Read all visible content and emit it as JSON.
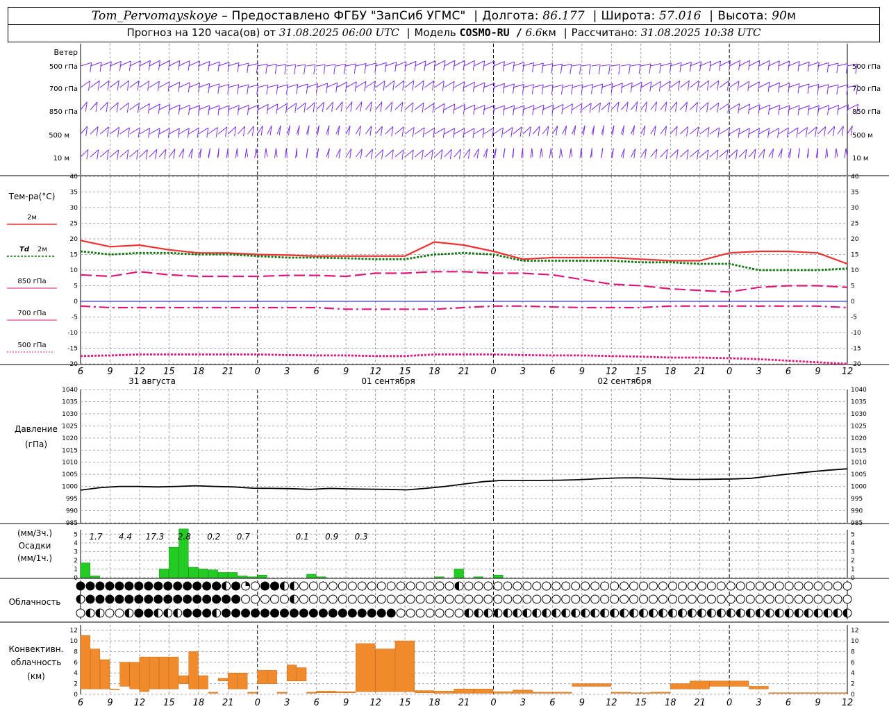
{
  "header": {
    "station": "Tom_Pervomayskoye",
    "provided": "– Предоставлено ФГБУ \"ЗапСиб УГМС\"",
    "lon_label": "Долгота:",
    "lon": "86.177",
    "lat_label": "Широта:",
    "lat": "57.016",
    "alt_label": "Высота:",
    "alt": "90",
    "alt_unit": "м",
    "forecast_label": "Прогноз на 120 часа(ов) от",
    "forecast_time": "31.08.2025 06:00 UTC",
    "model_label": "Модель",
    "model": "COSMO-RU /",
    "resolution": "6.6",
    "res_unit": "км",
    "calc_label": "Рассчитано:",
    "calc_time": "31.08.2025 10:38 UTC"
  },
  "labels": {
    "wind_title": "Ветер",
    "wind_levels": [
      "500 гПа",
      "700 гПа",
      "850 гПа",
      "500 м",
      "10 м"
    ],
    "temp_title": "Тем-ра(°С)",
    "temp_legend": [
      {
        "key": "2м",
        "prefix": "",
        "color": "#ee3030"
      },
      {
        "key": "2м",
        "prefix": "Td",
        "color": "#117711"
      },
      {
        "key": "850 гПа",
        "prefix": "",
        "color": "#e0157a"
      },
      {
        "key": "700 гПа",
        "prefix": "",
        "color": "#e0157a"
      },
      {
        "key": "500 гПа",
        "prefix": "",
        "color": "#e0157a"
      }
    ],
    "pressure_title": "Давление",
    "pressure_unit": "(гПа)",
    "precip_unit3": "(мм/3ч.)",
    "precip_title": "Осадки",
    "precip_unit1": "(мм/1ч.)",
    "cloud_title": "Облачность",
    "conv_title1": "Конвективн.",
    "conv_title2": "облачность",
    "conv_unit": "(км)",
    "days": [
      "31 августа",
      "01 сентября",
      "02 сентября"
    ],
    "hour_ticks": [
      "6",
      "9",
      "12",
      "15",
      "18",
      "21",
      "0",
      "3",
      "6",
      "9",
      "12",
      "15",
      "18",
      "21",
      "0",
      "3",
      "6",
      "9",
      "12",
      "15",
      "18",
      "21",
      "0",
      "3",
      "6",
      "9",
      "12"
    ]
  },
  "chart_data": [
    {
      "type": "line",
      "title": "Тем-ра(°С)",
      "x_hours": [
        0,
        3,
        6,
        9,
        12,
        15,
        18,
        21,
        24,
        27,
        30,
        33,
        36,
        39,
        42,
        45,
        48,
        51,
        54,
        57,
        60,
        63,
        66,
        69,
        72,
        75,
        78
      ],
      "ylim": [
        -20,
        40
      ],
      "series": [
        {
          "name": "2м",
          "color": "#ee3030",
          "style": "solid",
          "values": [
            19.5,
            17.5,
            18,
            16.5,
            15.5,
            15.5,
            15,
            14.8,
            14.5,
            14.5,
            14.5,
            14.5,
            19,
            18,
            16,
            13.5,
            14,
            14,
            14,
            13.5,
            13,
            13,
            15.5,
            16,
            16,
            15.5,
            12
          ]
        },
        {
          "name": "Td 2м",
          "color": "#117711",
          "style": "dotted",
          "values": [
            16,
            15,
            15.5,
            15.5,
            15,
            15,
            14.5,
            14,
            14,
            13.8,
            13.5,
            13.5,
            15,
            15.5,
            15,
            13,
            13,
            13,
            13,
            12.5,
            12.5,
            12,
            12,
            10,
            10,
            10,
            10.5
          ]
        },
        {
          "name": "850 гПа",
          "color": "#e0157a",
          "style": "dashed",
          "values": [
            8.5,
            8,
            9.5,
            8.5,
            8,
            8,
            8,
            8.3,
            8.3,
            8,
            9,
            9,
            9.5,
            9.5,
            9,
            9,
            8.5,
            7,
            5.5,
            5,
            4,
            3.5,
            3,
            4.5,
            5,
            5,
            4.5
          ]
        },
        {
          "name": "700 гПа",
          "color": "#e0157a",
          "style": "dashdot",
          "values": [
            -1.5,
            -2,
            -2,
            -2,
            -2,
            -2,
            -2,
            -2,
            -2,
            -2.5,
            -2.5,
            -2.5,
            -2.5,
            -2,
            -1.5,
            -1.5,
            -1.8,
            -2,
            -2,
            -2,
            -1.5,
            -1.5,
            -1.5,
            -1.5,
            -1.5,
            -1.5,
            -2
          ]
        },
        {
          "name": "500 гПа",
          "color": "#e0157a",
          "style": "dotted",
          "values": [
            -17.5,
            -17.3,
            -17,
            -17,
            -17,
            -17,
            -17,
            -17.2,
            -17.3,
            -17.3,
            -17.5,
            -17.5,
            -17,
            -17,
            -17,
            -17.2,
            -17.3,
            -17.3,
            -17.5,
            -17.7,
            -18,
            -18,
            -18.2,
            -18.5,
            -19,
            -19.5,
            -20
          ]
        }
      ]
    },
    {
      "type": "line",
      "title": "Давление",
      "x_hours": [
        0,
        3,
        6,
        9,
        12,
        15,
        18,
        21,
        24,
        27,
        30,
        33,
        36,
        39,
        42,
        45,
        48,
        51,
        54,
        57,
        60,
        63,
        66,
        69,
        72,
        75,
        78,
        81,
        84,
        87,
        90,
        93,
        96,
        99,
        102,
        105,
        108,
        111,
        114,
        117,
        120
      ],
      "ylim": [
        985,
        1040
      ],
      "series": [
        {
          "name": "",
          "color": "#000000",
          "values": [
            998.5,
            999.5,
            1000,
            1000,
            999.8,
            1000,
            1000.3,
            1000,
            999.8,
            999.3,
            999.2,
            999.1,
            998.8,
            999.2,
            999,
            998.9,
            998.8,
            998.6,
            999.2,
            1000,
            1001,
            1002,
            1002.5,
            1002.5,
            1002.5,
            1002.6,
            1002.8,
            1003.2,
            1003.5,
            1003.6,
            1003.4,
            1003,
            1002.9,
            1003,
            1003.1,
            1003.4,
            1004.3,
            1005.2,
            1006,
            1006.7,
            1007.3
          ]
        }
      ]
    },
    {
      "type": "bar",
      "title": "Осадки",
      "x_hours_start": [
        0,
        1,
        2,
        3,
        4,
        5,
        6,
        7,
        8,
        9,
        10,
        11,
        12,
        13,
        14,
        15,
        16,
        17,
        18,
        19,
        20,
        21,
        22,
        23,
        24,
        27,
        30,
        33,
        36,
        38,
        40,
        42,
        44
      ],
      "ylim": [
        0,
        5.5
      ],
      "values": [
        1.7,
        0.2,
        0,
        0,
        0,
        0,
        0,
        0,
        1.0,
        3.5,
        5.6,
        1.2,
        1.0,
        0.9,
        0.6,
        0.6,
        0.2,
        0.1,
        0.3,
        0,
        0,
        0,
        0,
        0.4,
        0.1,
        0,
        0,
        0,
        0.1,
        1.0,
        0.1,
        0.3,
        0
      ],
      "totals_3h": [
        "1.7",
        "4.4",
        "17.3",
        "2.8",
        "0.2",
        "0.7",
        "",
        "0.1",
        "0.9",
        "0.3"
      ]
    },
    {
      "type": "bar",
      "title": "Конвективн. облачность",
      "x_hours_start": [
        0,
        1,
        2,
        3,
        4,
        5,
        6,
        7,
        8,
        9,
        10,
        11,
        12,
        13,
        14,
        15,
        16,
        17,
        18,
        19,
        20,
        21,
        22,
        23,
        24,
        26,
        28,
        30,
        32,
        34,
        36,
        38,
        40,
        42,
        44,
        46,
        48,
        50,
        52,
        54,
        56,
        58,
        60,
        62,
        64,
        66,
        68,
        70,
        72,
        74,
        76,
        78,
        80,
        82,
        84,
        86,
        88,
        90,
        92,
        94,
        96,
        98,
        100,
        102,
        104,
        106,
        108,
        110,
        112,
        114,
        116,
        118,
        120
      ],
      "ylim": [
        0,
        13
      ],
      "segments": [
        [
          1,
          11
        ],
        [
          1,
          8.5
        ],
        [
          1,
          6.5
        ],
        [
          1,
          1
        ],
        [
          1.5,
          6
        ],
        [
          1,
          6
        ],
        [
          0.5,
          7
        ],
        [
          1,
          7
        ],
        [
          1,
          7
        ],
        [
          1,
          7
        ],
        [
          2,
          3.5
        ],
        [
          1,
          8
        ],
        [
          1,
          3.5
        ],
        [
          0.2,
          0.4
        ],
        [
          2.5,
          3
        ],
        [
          1,
          4
        ],
        [
          1,
          4
        ],
        [
          0.2,
          0.4
        ],
        [
          2,
          4.5
        ],
        [
          2,
          4.5
        ],
        [
          0.2,
          0.4
        ],
        [
          2.5,
          5.5
        ],
        [
          2.5,
          5
        ],
        [
          0.2,
          0.4
        ],
        [
          0.3,
          0.6
        ],
        [
          0.3,
          0.5
        ],
        [
          0.5,
          9.5
        ],
        [
          0.5,
          8.5
        ],
        [
          0.5,
          10
        ],
        [
          0.3,
          0.7
        ],
        [
          0.2,
          0.6
        ],
        [
          0.2,
          1
        ],
        [
          0.2,
          1
        ],
        [
          0.2,
          0.5
        ],
        [
          0.2,
          0.8
        ],
        [
          0.2,
          0.4
        ],
        [
          0.2,
          0.4
        ],
        [
          1.5,
          2
        ],
        [
          1.5,
          2
        ],
        [
          0.2,
          0.4
        ],
        [
          0.2,
          0.3
        ],
        [
          0.2,
          0.4
        ],
        [
          1,
          2
        ],
        [
          1,
          2.5
        ],
        [
          1.5,
          2.5
        ],
        [
          1.5,
          2.5
        ],
        [
          1,
          1.5
        ],
        [
          0.2,
          0.3
        ],
        [
          0.2,
          0.3
        ],
        [
          0.2,
          0.3
        ],
        [
          0.2,
          0.3
        ],
        [
          0.3,
          0.6
        ],
        [
          0.5,
          1
        ],
        [
          0.5,
          1
        ],
        [
          0.5,
          1
        ],
        [
          0.5,
          1
        ],
        [
          0.5,
          1.2
        ],
        [
          0.5,
          1.5
        ],
        [
          0.5,
          1.8
        ],
        [
          0.5,
          2
        ],
        [
          0.5,
          2
        ],
        [
          0.5,
          2.2
        ],
        [
          0.3,
          0.6
        ],
        [
          0.2,
          0.3
        ],
        [
          0.5,
          2
        ],
        [
          0.5,
          2.5
        ],
        [
          0.2,
          0.3
        ],
        [
          0.5,
          3.5
        ]
      ]
    }
  ],
  "cloud_symbols": {
    "rows": [
      "FFFFFFFFFFFFFFFHFQEFFHHEEEEEEEEEEEEEEEEHEEEEEEEEEEEEEEEEEEEEEEEEEEEEEEEEEEEEEEEEEEEEEEEEEEEEEEEEEEEEEEEEEEEEEEEEEEEEEEEEEE",
      "HFFFFFFFFFFFFFFFFEEEEEHEEEEEEEEEEEEEEEEEEEEEEEEEEEEEEEEEEEEEEEEEEEEEEEEEEEEEEEEEEEEEEEEEEEEEEEEEEEEEEEEEEEEEEEEEEEEEEEEEEEEEEEQE",
      "EHHEEHFFHHHFFFHFFFFFFFFFFFFFFFFFFEEEEEEEHHHHHHHHHHHHHHHHHHHHHHHHHHHHHHHHHHHHHHHHHHHHHHFFFFFFFFFFFFFFFFFFFFFFFFFFFFEEHH"
    ]
  }
}
